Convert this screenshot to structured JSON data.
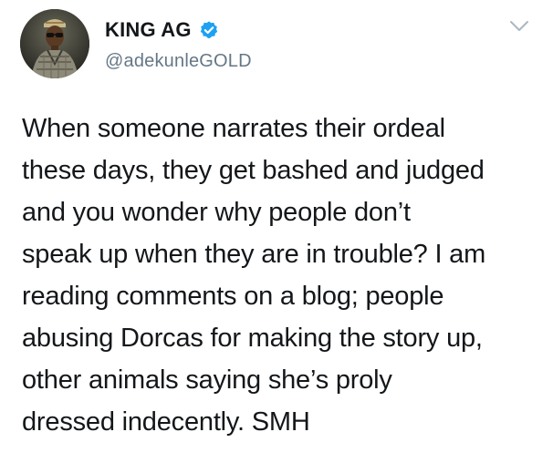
{
  "author": {
    "display_name": "KING AG",
    "handle": "@adekunleGOLD",
    "verified": true,
    "avatar_icon": "profile-photo"
  },
  "tweet": {
    "lines": [
      "When someone narrates their ordeal",
      "these days, they get bashed and judged",
      "and you wonder why people don’t",
      "speak up when they are in trouble? I am",
      "reading comments on a blog; people",
      "abusing Dorcas for making the story up,",
      "other animals saying she’s proly",
      "dressed indecently. SMH"
    ]
  },
  "menu": {
    "icon": "chevron-down-icon"
  },
  "colors": {
    "text": "#14171a",
    "secondary": "#657786",
    "verified": "#1da1f2",
    "chevron": "#aab8c2"
  }
}
